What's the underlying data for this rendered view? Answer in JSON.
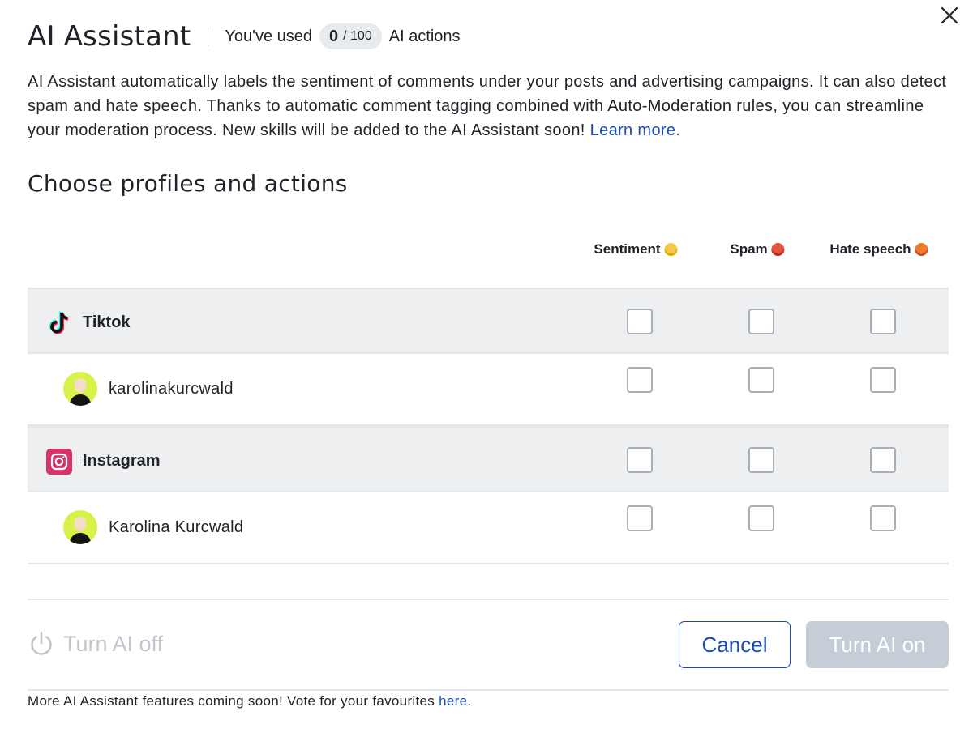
{
  "header": {
    "title": "AI Assistant",
    "usage_prefix": "You've used",
    "usage_count": "0",
    "usage_max": "/ 100",
    "usage_suffix": "AI actions"
  },
  "description": {
    "text": "AI Assistant automatically labels the sentiment of comments under your posts and advertising campaigns. It can also detect spam and hate speech. Thanks to automatic comment tagging combined with Auto-Moderation rules, you can streamline your moderation process. New skills will be added to the AI Assistant soon!",
    "link": "Learn more."
  },
  "section_title": "Choose profiles and actions",
  "columns": [
    {
      "label": "Sentiment",
      "emoji_icon": "neutral-face-emoji-icon"
    },
    {
      "label": "Spam",
      "emoji_icon": "stop-sign-emoji-icon"
    },
    {
      "label": "Hate speech",
      "emoji_icon": "angry-face-emoji-icon"
    }
  ],
  "rows": [
    {
      "type": "group",
      "platform": "Tiktok",
      "icon": "tiktok-icon",
      "checks": [
        false,
        false,
        false
      ]
    },
    {
      "type": "profile",
      "name": "karolinakurcwald",
      "checks": [
        false,
        false,
        false
      ]
    },
    {
      "type": "group",
      "platform": "Instagram",
      "icon": "instagram-icon",
      "checks": [
        false,
        false,
        false
      ]
    },
    {
      "type": "profile",
      "name": "Karolina Kurcwald",
      "checks": [
        false,
        false,
        false
      ]
    }
  ],
  "actions": {
    "turn_off": "Turn AI off",
    "cancel": "Cancel",
    "turn_on": "Turn AI on"
  },
  "footer": {
    "text": "More AI Assistant features coming soon! Vote for your favourites",
    "link": "here",
    "end": "."
  },
  "colors": {
    "link": "#1c4db5",
    "group_bg": "#eeeff1",
    "disabled_button": "#c5cdd6",
    "instagram": "#d6336c",
    "avatar_bg": "#d9f24a"
  }
}
